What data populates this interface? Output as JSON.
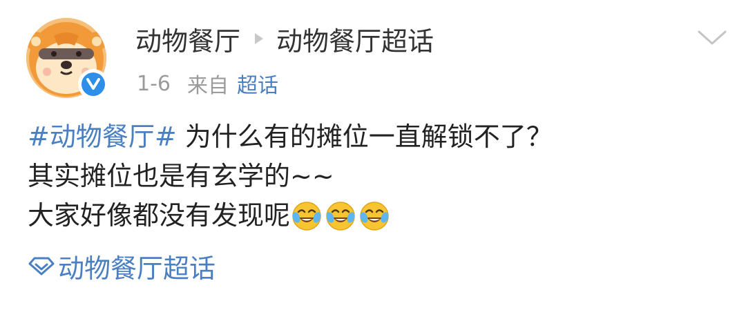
{
  "header": {
    "username": "动物餐厅",
    "separator_icon": "triangle-right-icon",
    "topic": "动物餐厅超话",
    "date": "1-6",
    "from_label": "来自",
    "source": "超话",
    "menu_icon": "chevron-down-icon",
    "verified_icon": "verified-v-icon"
  },
  "post": {
    "hashtag": "#动物餐厅#",
    "line1_text": "为什么有的摊位一直解锁不了？",
    "line2_text": "其实摊位也是有玄学的~~",
    "line3_text": "大家好像都没有发现呢",
    "emojis": [
      "laughing-crying-emoji",
      "laughing-crying-emoji",
      "laughing-crying-emoji"
    ]
  },
  "topic_link": {
    "icon": "diamond-icon",
    "label": "动物餐厅超话"
  },
  "colors": {
    "link": "#4a7fc1",
    "meta": "#9b9b9b",
    "verified": "#2e8ee8"
  }
}
